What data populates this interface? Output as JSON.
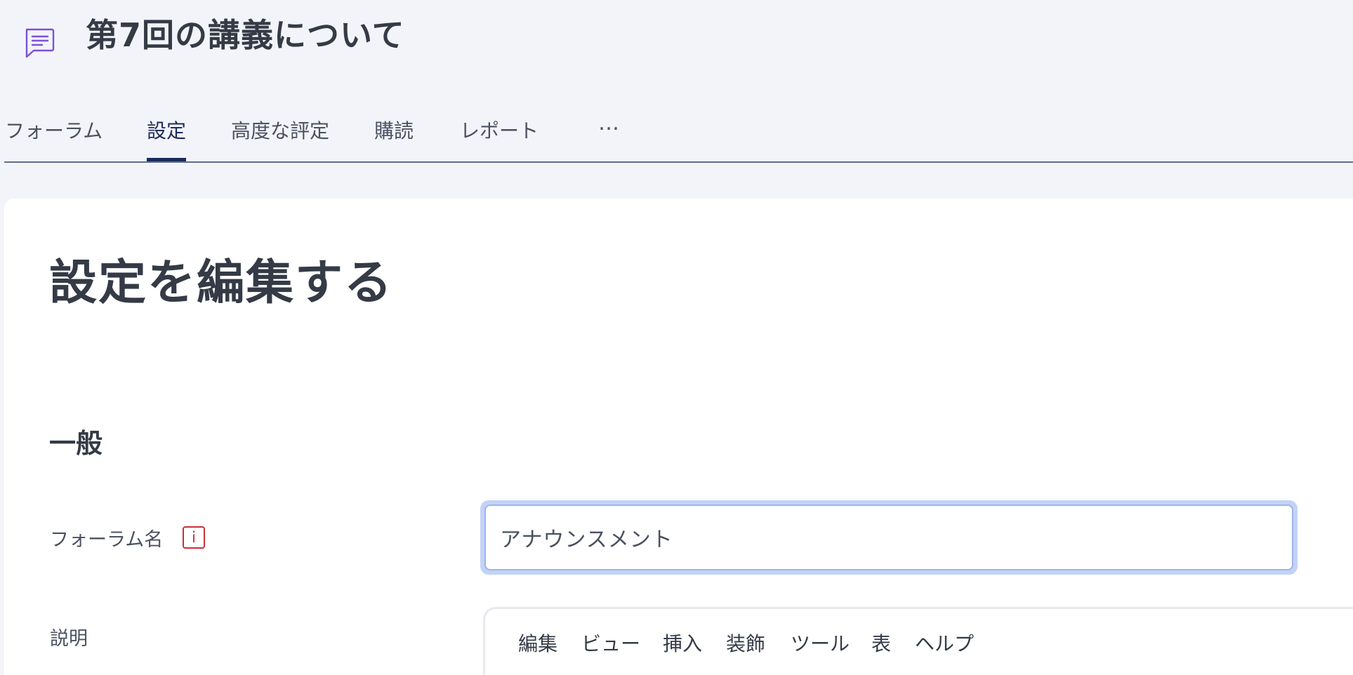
{
  "header": {
    "icon": "forum-chat-icon",
    "title": "第7回の講義について"
  },
  "tabs": [
    {
      "label": "フォーラム",
      "active": false
    },
    {
      "label": "設定",
      "active": true
    },
    {
      "label": "高度な評定",
      "active": false
    },
    {
      "label": "購読",
      "active": false
    },
    {
      "label": "レポート",
      "active": false
    },
    {
      "label": "…",
      "active": false
    }
  ],
  "main": {
    "heading": "設定を編集する",
    "section": "一般",
    "forum_name": {
      "label": "フォーラム名",
      "required_icon_glyph": "i",
      "value": "アナウンスメント"
    },
    "description": {
      "label": "説明",
      "editor_menu": [
        "編集",
        "ビュー",
        "挿入",
        "装飾",
        "ツール",
        "表",
        "ヘルプ"
      ]
    }
  },
  "colors": {
    "background": "#f3f4f9",
    "accent": "#1d2b5c",
    "icon": "#7b52d8",
    "required": "#c9303a",
    "focus": "#c3d2f7"
  }
}
